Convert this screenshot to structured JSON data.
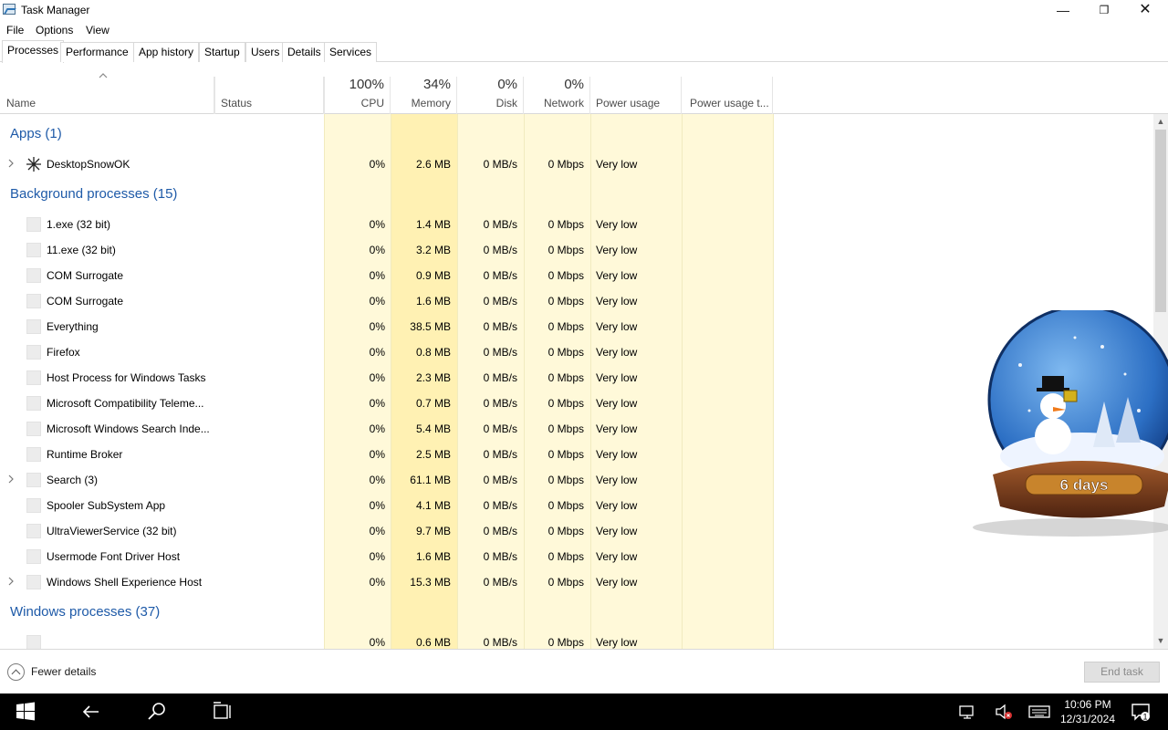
{
  "window": {
    "title": "Task Manager"
  },
  "menu": [
    "File",
    "Options",
    "View"
  ],
  "tabs": [
    "Processes",
    "Performance",
    "App history",
    "Startup",
    "Users",
    "Details",
    "Services"
  ],
  "columns": {
    "name": "Name",
    "status": "Status",
    "cpu": {
      "pct": "100%",
      "label": "CPU"
    },
    "memory": {
      "pct": "34%",
      "label": "Memory"
    },
    "disk": {
      "pct": "0%",
      "label": "Disk"
    },
    "network": {
      "pct": "0%",
      "label": "Network"
    },
    "power": "Power usage",
    "power_trend": "Power usage t..."
  },
  "groups": {
    "apps": "Apps (1)",
    "background": "Background processes (15)",
    "windows": "Windows processes (37)"
  },
  "apps": [
    {
      "name": "DesktopSnowOK",
      "cpu": "0%",
      "mem": "2.6 MB",
      "disk": "0 MB/s",
      "net": "0 Mbps",
      "power": "Very low"
    }
  ],
  "background": [
    {
      "name": "1.exe (32 bit)",
      "cpu": "0%",
      "mem": "1.4 MB",
      "disk": "0 MB/s",
      "net": "0 Mbps",
      "power": "Very low"
    },
    {
      "name": "11.exe (32 bit)",
      "cpu": "0%",
      "mem": "3.2 MB",
      "disk": "0 MB/s",
      "net": "0 Mbps",
      "power": "Very low"
    },
    {
      "name": "COM Surrogate",
      "cpu": "0%",
      "mem": "0.9 MB",
      "disk": "0 MB/s",
      "net": "0 Mbps",
      "power": "Very low"
    },
    {
      "name": "COM Surrogate",
      "cpu": "0%",
      "mem": "1.6 MB",
      "disk": "0 MB/s",
      "net": "0 Mbps",
      "power": "Very low"
    },
    {
      "name": "Everything",
      "cpu": "0%",
      "mem": "38.5 MB",
      "disk": "0 MB/s",
      "net": "0 Mbps",
      "power": "Very low"
    },
    {
      "name": "Firefox",
      "cpu": "0%",
      "mem": "0.8 MB",
      "disk": "0 MB/s",
      "net": "0 Mbps",
      "power": "Very low"
    },
    {
      "name": "Host Process for Windows Tasks",
      "cpu": "0%",
      "mem": "2.3 MB",
      "disk": "0 MB/s",
      "net": "0 Mbps",
      "power": "Very low"
    },
    {
      "name": "Microsoft Compatibility Teleme...",
      "cpu": "0%",
      "mem": "0.7 MB",
      "disk": "0 MB/s",
      "net": "0 Mbps",
      "power": "Very low"
    },
    {
      "name": "Microsoft Windows Search Inde...",
      "cpu": "0%",
      "mem": "5.4 MB",
      "disk": "0 MB/s",
      "net": "0 Mbps",
      "power": "Very low"
    },
    {
      "name": "Runtime Broker",
      "cpu": "0%",
      "mem": "2.5 MB",
      "disk": "0 MB/s",
      "net": "0 Mbps",
      "power": "Very low"
    },
    {
      "name": "Search (3)",
      "cpu": "0%",
      "mem": "61.1 MB",
      "disk": "0 MB/s",
      "net": "0 Mbps",
      "power": "Very low",
      "expandable": true
    },
    {
      "name": "Spooler SubSystem App",
      "cpu": "0%",
      "mem": "4.1 MB",
      "disk": "0 MB/s",
      "net": "0 Mbps",
      "power": "Very low"
    },
    {
      "name": "UltraViewerService (32 bit)",
      "cpu": "0%",
      "mem": "9.7 MB",
      "disk": "0 MB/s",
      "net": "0 Mbps",
      "power": "Very low"
    },
    {
      "name": "Usermode Font Driver Host",
      "cpu": "0%",
      "mem": "1.6 MB",
      "disk": "0 MB/s",
      "net": "0 Mbps",
      "power": "Very low"
    },
    {
      "name": "Windows Shell Experience Host",
      "cpu": "0%",
      "mem": "15.3 MB",
      "disk": "0 MB/s",
      "net": "0 Mbps",
      "power": "Very low",
      "expandable": true
    }
  ],
  "windows_procs": [
    {
      "name": "",
      "cpu": "0%",
      "mem": "0.6 MB",
      "disk": "0 MB/s",
      "net": "0 Mbps",
      "power": "Very low"
    }
  ],
  "footer": {
    "fewer_details": "Fewer details",
    "end_task": "End task"
  },
  "desktop_widget": {
    "label": "6 days"
  },
  "taskbar": {
    "time": "10:06 PM",
    "date": "12/31/2024",
    "notification_count": "1"
  },
  "colors": {
    "heat_light": "#fff9d9",
    "heat_medium": "#fff1b3",
    "group_blue": "#1e5aa8"
  }
}
